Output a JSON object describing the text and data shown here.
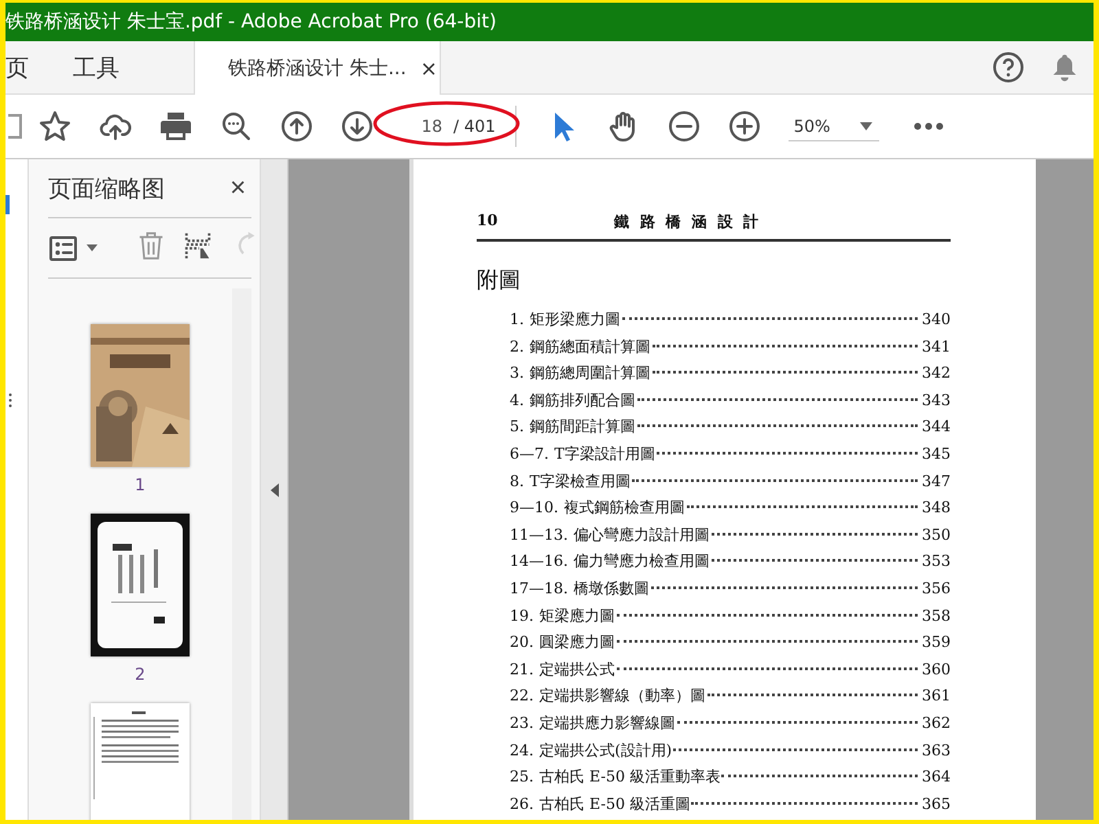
{
  "window": {
    "title": "铁路桥涵设计 朱士宝.pdf - Adobe Acrobat Pro (64-bit)"
  },
  "tabs": [
    {
      "label": "页",
      "kind": "nav",
      "selected": false
    },
    {
      "label": "工具",
      "kind": "nav",
      "selected": false
    },
    {
      "label": "铁路桥涵设计 朱士...",
      "kind": "document",
      "selected": true,
      "close": "×"
    }
  ],
  "toolbar": {
    "tools": [
      {
        "kind": "bookmark"
      },
      {
        "kind": "upload"
      },
      {
        "kind": "print"
      },
      {
        "kind": "zoom-search"
      },
      {
        "kind": "prev-page"
      },
      {
        "kind": "next-page"
      }
    ],
    "page": {
      "current": "18",
      "total": "/ 401",
      "circled": true
    },
    "modes": [
      {
        "kind": "pointer",
        "selected": true
      },
      {
        "kind": "hand",
        "selected": false
      }
    ],
    "zoom_tools": [
      {
        "kind": "out"
      },
      {
        "kind": "in"
      }
    ],
    "zoom": {
      "value": "50%"
    }
  },
  "thumbnail_panel": {
    "title": "页面缩略图",
    "close": "×",
    "actions": [
      {
        "kind": "options",
        "disabled": false
      },
      {
        "kind": "delete",
        "disabled": false
      },
      {
        "kind": "insert",
        "disabled": false
      },
      {
        "kind": "rotate",
        "disabled": true
      }
    ],
    "pages": [
      {
        "label": "1",
        "kind": "cover"
      },
      {
        "label": "2",
        "kind": "dark"
      },
      {
        "kind": "text"
      }
    ]
  },
  "document": {
    "page_number": "10",
    "running_title": "鐵 路 橋 涵 設 計",
    "heading": "附圖",
    "entries": [
      {
        "number": "1.",
        "title": "矩形梁應力圖",
        "page": "340"
      },
      {
        "number": "2.",
        "title": "鋼筋總面積計算圖",
        "page": "341"
      },
      {
        "number": "3.",
        "title": "鋼筋總周圍計算圖",
        "page": "342"
      },
      {
        "number": "4.",
        "title": "鋼筋排列配合圖",
        "page": "343"
      },
      {
        "number": "5.",
        "title": "鋼筋間距計算圖",
        "page": "344"
      },
      {
        "number": "6—7.",
        "title": "T字梁設計用圖",
        "page": "345"
      },
      {
        "number": "8.",
        "title": "T字梁檢查用圖",
        "page": "347"
      },
      {
        "number": "9—10.",
        "title": "複式鋼筋檢查用圖",
        "page": "348"
      },
      {
        "number": "11—13.",
        "title": "偏心彎應力設計用圖",
        "page": "350"
      },
      {
        "number": "14—16.",
        "title": "偏力彎應力檢查用圖",
        "page": "353"
      },
      {
        "number": "17—18.",
        "title": "橋墩係數圖",
        "page": "356"
      },
      {
        "number": "19.",
        "title": "矩梁應力圖",
        "page": "358"
      },
      {
        "number": "20.",
        "title": "圓梁應力圖",
        "page": "359"
      },
      {
        "number": "21.",
        "title": "定端拱公式",
        "page": "360"
      },
      {
        "number": "22.",
        "title": "定端拱影響線（動率）圖",
        "page": "361"
      },
      {
        "number": "23.",
        "title": "定端拱應力影響線圖",
        "page": "362"
      },
      {
        "number": "24.",
        "title": "定端拱公式(設計用)",
        "page": "363"
      },
      {
        "number": "25.",
        "title": "古柏氏 E-50 級活重動率表",
        "page": "364"
      },
      {
        "number": "26.",
        "title": "古柏氏 E-50 級活重圖",
        "page": "365"
      }
    ]
  }
}
